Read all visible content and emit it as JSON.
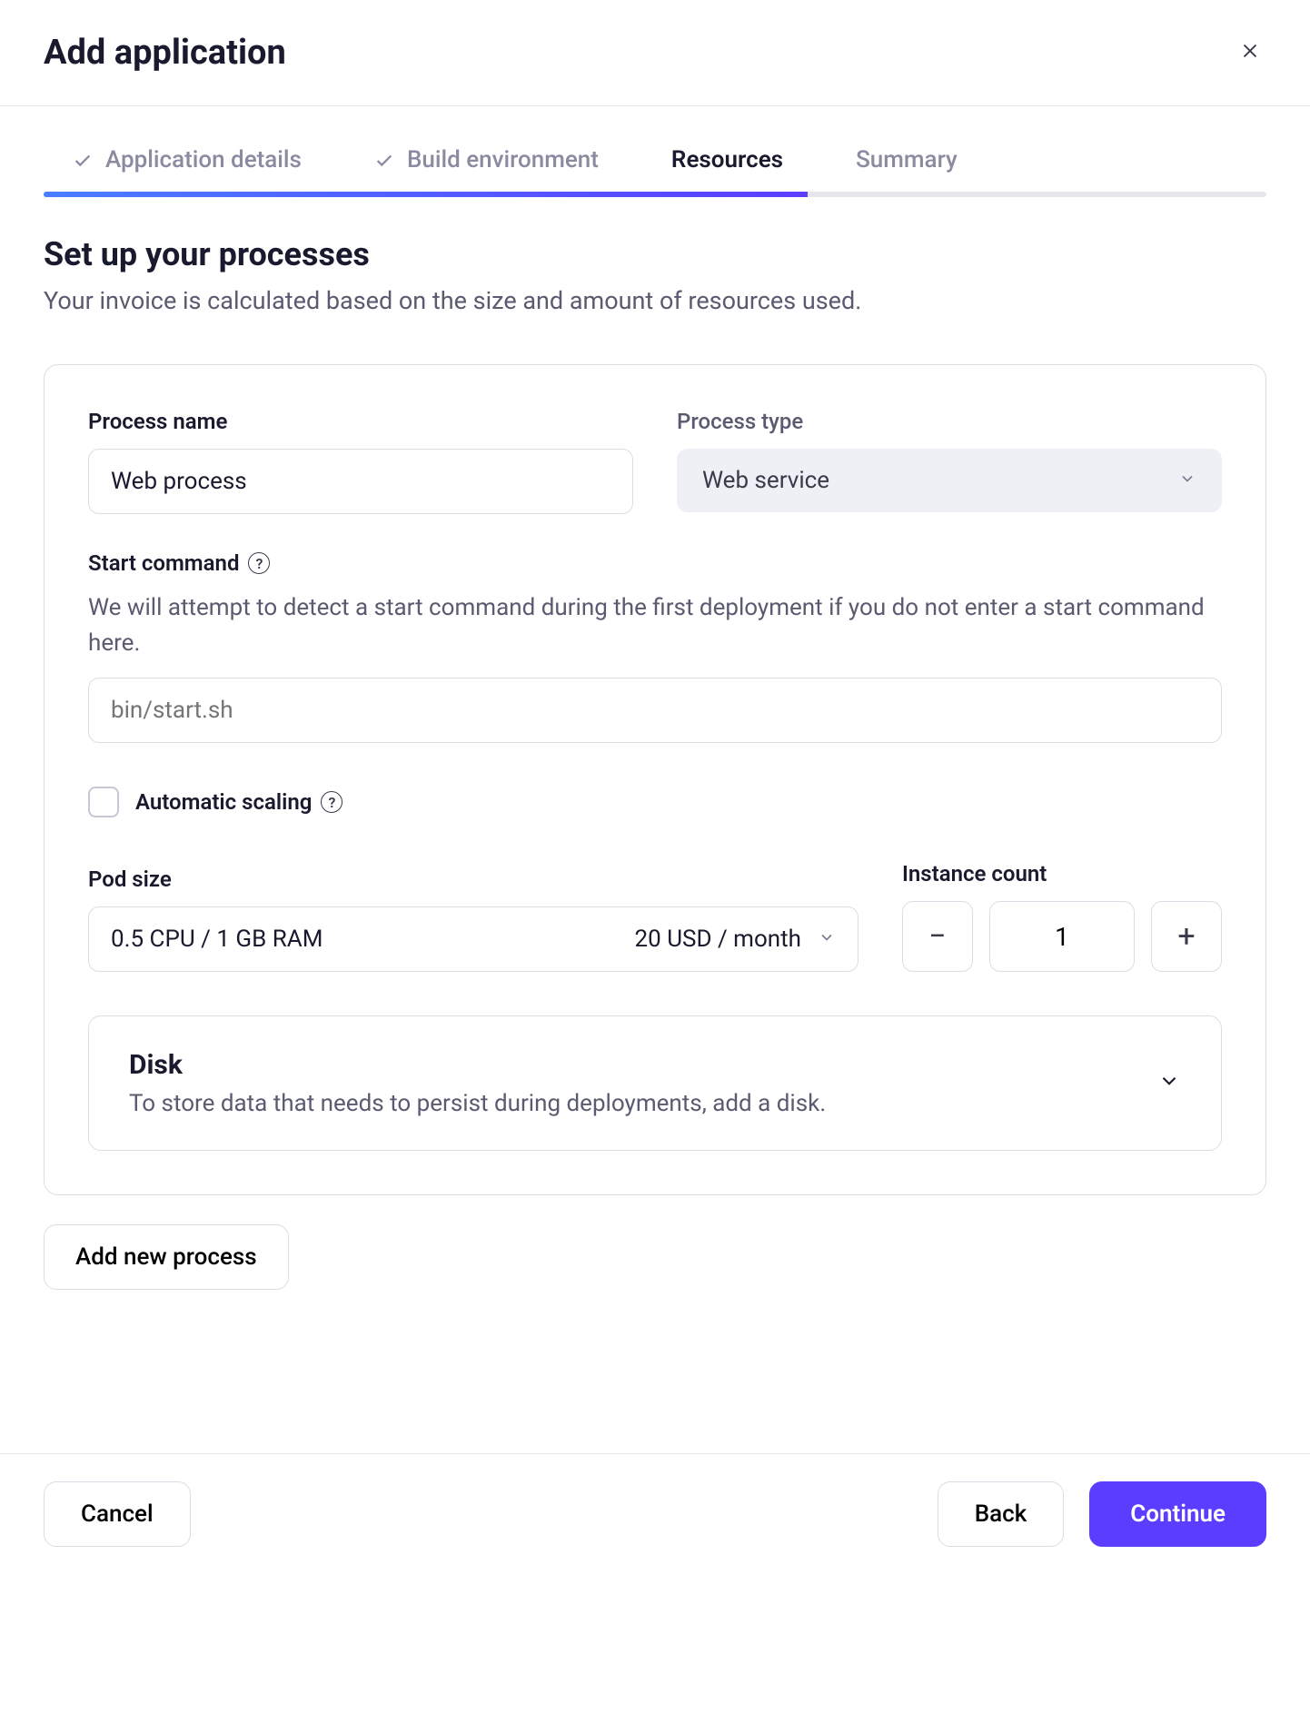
{
  "header": {
    "title": "Add application"
  },
  "steps": {
    "app_details": "Application details",
    "build_env": "Build environment",
    "resources": "Resources",
    "summary": "Summary"
  },
  "section": {
    "title": "Set up your processes",
    "desc": "Your invoice is calculated based on the size and amount of resources used."
  },
  "process": {
    "name_label": "Process name",
    "name_value": "Web process",
    "type_label": "Process type",
    "type_value": "Web service",
    "start_cmd_label": "Start command",
    "start_cmd_help": "We will attempt to detect a start command during the first deployment if you do not enter a start command here.",
    "start_cmd_placeholder": "bin/start.sh",
    "auto_scaling_label": "Automatic scaling",
    "pod_size_label": "Pod size",
    "pod_size_value": "0.5 CPU / 1 GB RAM",
    "pod_size_price": "20 USD / month",
    "instance_count_label": "Instance count",
    "instance_count_value": "1",
    "disk_title": "Disk",
    "disk_desc": "To store data that needs to persist during deployments, add a disk."
  },
  "buttons": {
    "add_process": "Add new process",
    "cancel": "Cancel",
    "back": "Back",
    "continue": "Continue"
  }
}
